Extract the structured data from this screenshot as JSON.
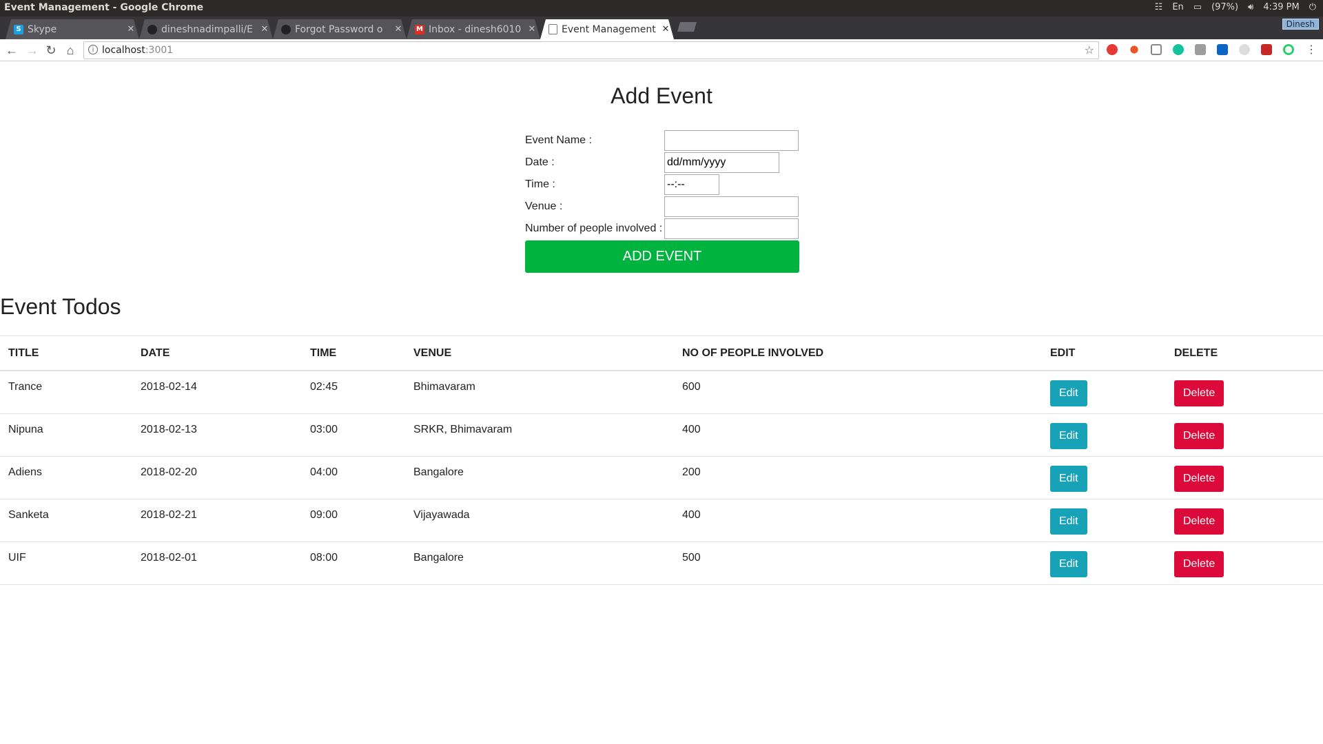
{
  "window": {
    "title": "Event Management - Google Chrome"
  },
  "system": {
    "battery": "(97%)",
    "clock": "4:39 PM",
    "kbd": "En"
  },
  "tabs": [
    {
      "label": "Skype",
      "fav": "S",
      "fav_color": "#1ba1e2"
    },
    {
      "label": "dineshnadimpalli/E",
      "fav": "",
      "fav_color": "#111111"
    },
    {
      "label": "Forgot Password o",
      "fav": "",
      "fav_color": "#111111"
    },
    {
      "label": "Inbox - dinesh6010",
      "fav": "M",
      "fav_color": "#d93025"
    },
    {
      "label": "Event Management",
      "fav": "",
      "fav_color": "#ffffff"
    }
  ],
  "profile": "Dinesh",
  "address": {
    "host": "localhost",
    "port": ":3001"
  },
  "form": {
    "title": "Add Event",
    "event_name_label": "Event Name :",
    "date_label": "Date :",
    "date_value": "dd/mm/yyyy",
    "time_label": "Time :",
    "time_value": "--:--",
    "venue_label": "Venue :",
    "people_label": "Number of people involved :",
    "submit_label": "ADD EVENT"
  },
  "list": {
    "title": "Event Todos",
    "headers": [
      "TITLE",
      "DATE",
      "TIME",
      "VENUE",
      "NO OF PEOPLE INVOLVED",
      "EDIT",
      "DELETE"
    ],
    "edit_label": "Edit",
    "delete_label": "Delete",
    "rows": [
      {
        "title": "Trance",
        "date": "2018-02-14",
        "time": "02:45",
        "venue": "Bhimavaram",
        "people": "600"
      },
      {
        "title": "Nipuna",
        "date": "2018-02-13",
        "time": "03:00",
        "venue": "SRKR, Bhimavaram",
        "people": "400"
      },
      {
        "title": "Adiens",
        "date": "2018-02-20",
        "time": "04:00",
        "venue": "Bangalore",
        "people": "200"
      },
      {
        "title": "Sanketa",
        "date": "2018-02-21",
        "time": "09:00",
        "venue": "Vijayawada",
        "people": "400"
      },
      {
        "title": "UIF",
        "date": "2018-02-01",
        "time": "08:00",
        "venue": "Bangalore",
        "people": "500"
      }
    ]
  },
  "colors": {
    "add_button": "#00b33f",
    "edit_button": "#17a2b8",
    "delete_button": "#dc0a3b"
  }
}
